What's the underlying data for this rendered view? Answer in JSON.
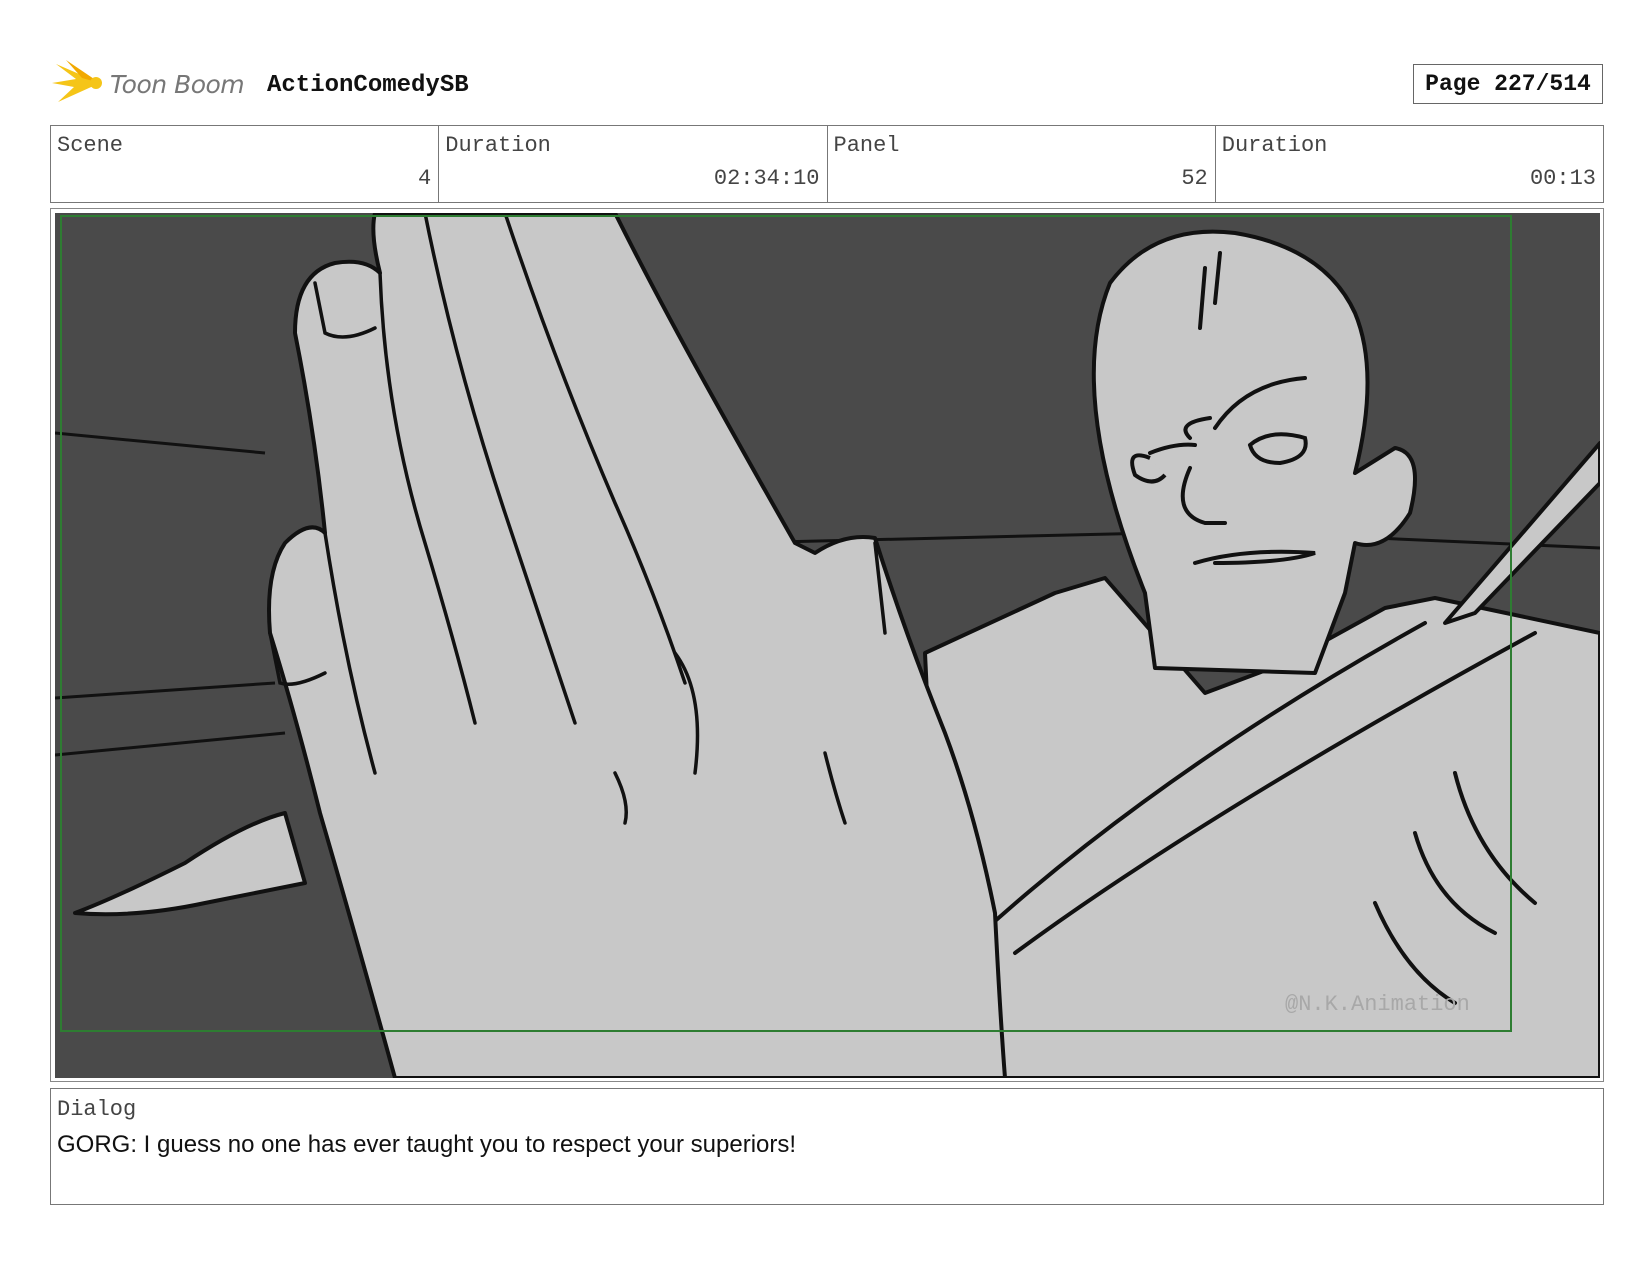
{
  "header": {
    "logo_text": "Toon Boom",
    "project_title": "ActionComedySB",
    "page_label": "Page 227/514"
  },
  "info": {
    "scene_label": "Scene",
    "scene_value": "4",
    "scene_duration_label": "Duration",
    "scene_duration_value": "02:34:10",
    "panel_label": "Panel",
    "panel_value": "52",
    "panel_duration_label": "Duration",
    "panel_duration_value": "00:13"
  },
  "panel": {
    "watermark": "@N.K.Animation"
  },
  "dialog": {
    "label": "Dialog",
    "text": "GORG: I guess no one has ever taught you to respect your superiors!"
  },
  "colors": {
    "background": "#4a4a4a",
    "fill": "#c8c8c8",
    "frame_green": "#2e7d32",
    "logo_yellow": "#f5c518"
  }
}
